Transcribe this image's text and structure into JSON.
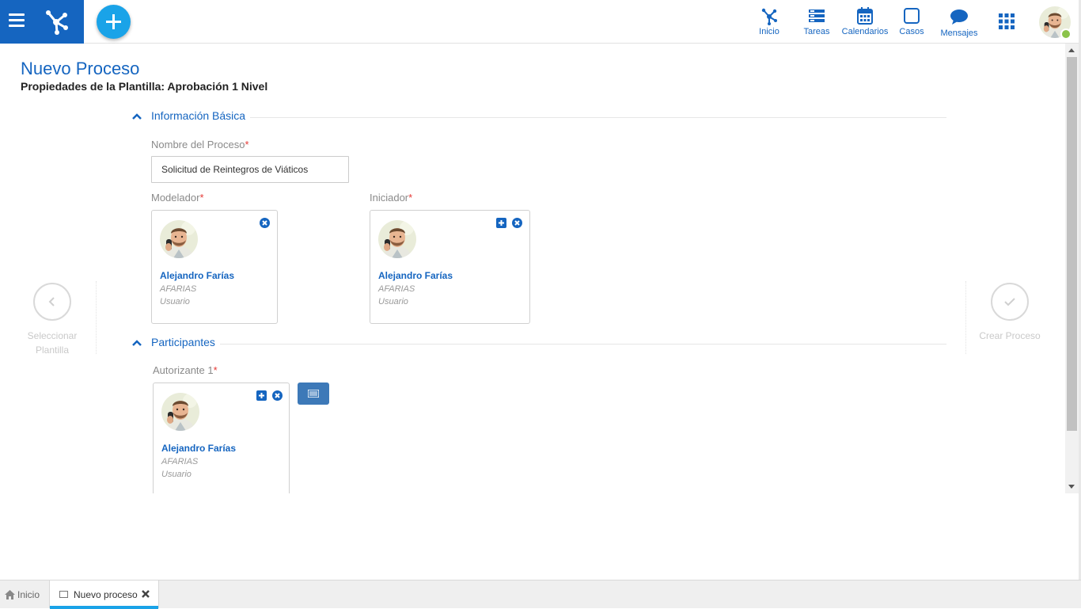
{
  "topbar": {
    "nav": [
      {
        "label": "Inicio",
        "icon": "process-network-icon"
      },
      {
        "label": "Tareas",
        "icon": "tasks-icon"
      },
      {
        "label": "Calendarios",
        "icon": "calendar-icon"
      },
      {
        "label": "Casos",
        "icon": "cases-icon"
      },
      {
        "label": "Mensajes",
        "icon": "messages-icon"
      }
    ],
    "apps_icon": "apps-grid-icon",
    "status_color": "#8bc34a"
  },
  "page": {
    "title": "Nuevo Proceso",
    "subtitle": "Propiedades de la Plantilla: Aprobación 1 Nivel"
  },
  "basic_info": {
    "section_title": "Información Básica",
    "process_name_label": "Nombre del Proceso",
    "process_name_value": "Solicitud de Reintegros de Viáticos",
    "modeler_label": "Modelador",
    "initiator_label": "Iniciador",
    "required_mark": "*"
  },
  "modeler": {
    "name": "Alejandro Farías",
    "login": "AFARIAS",
    "role": "Usuario"
  },
  "initiator": {
    "name": "Alejandro Farías",
    "login": "AFARIAS",
    "role": "Usuario"
  },
  "participants": {
    "section_title": "Participantes",
    "authorizer_label": "Autorizante 1",
    "authorizer": {
      "name": "Alejandro Farías",
      "login": "AFARIAS",
      "role": "Usuario"
    }
  },
  "side_nav": {
    "prev_label_line1": "Seleccionar",
    "prev_label_line2": "Plantilla",
    "next_label": "Crear Proceso"
  },
  "tabs": {
    "home_label": "Inicio",
    "active_label": "Nuevo proceso"
  },
  "colors": {
    "brand": "#1565c0",
    "accent": "#1aa3e8",
    "required": "#e53935"
  }
}
